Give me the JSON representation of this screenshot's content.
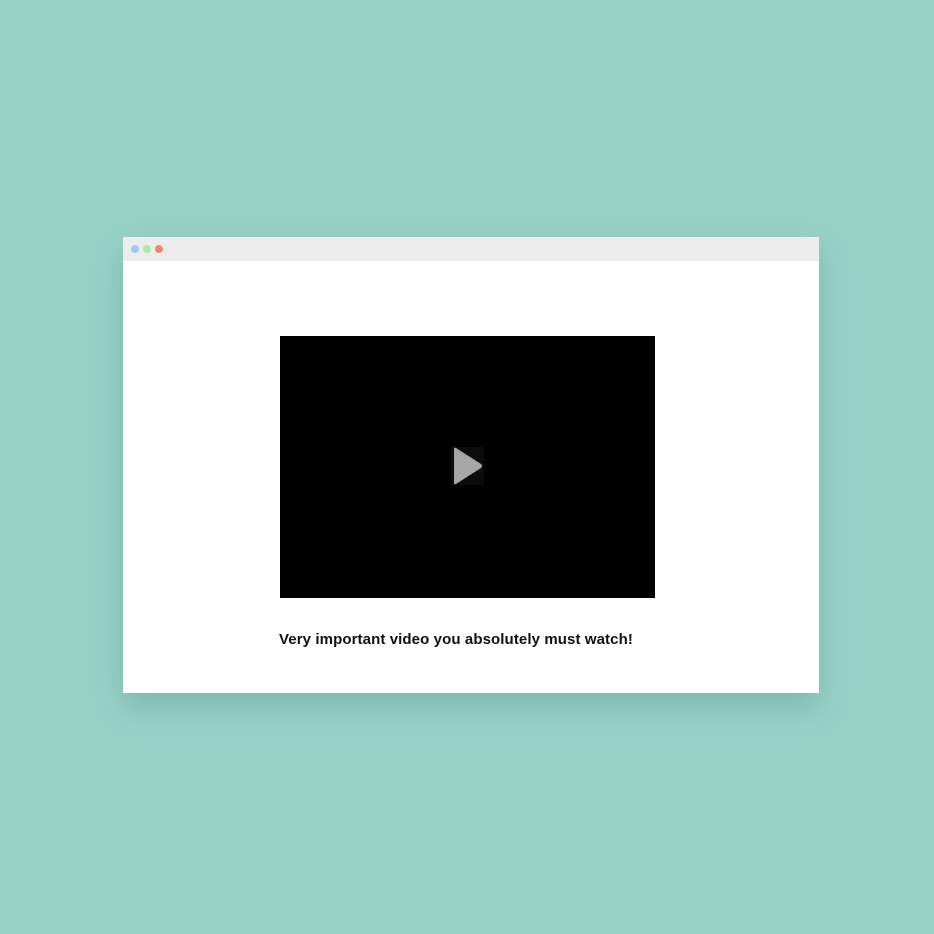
{
  "page": {
    "background_color": "#97d2c7"
  },
  "window": {
    "controls": [
      {
        "name": "blue-dot",
        "color": "#9fcbe9"
      },
      {
        "name": "green-dot",
        "color": "#a8ecaa"
      },
      {
        "name": "red-dot",
        "color": "#ed8a6c"
      }
    ]
  },
  "video": {
    "play_icon": "play-icon",
    "caption": "Very important video you absolutely must watch!"
  }
}
